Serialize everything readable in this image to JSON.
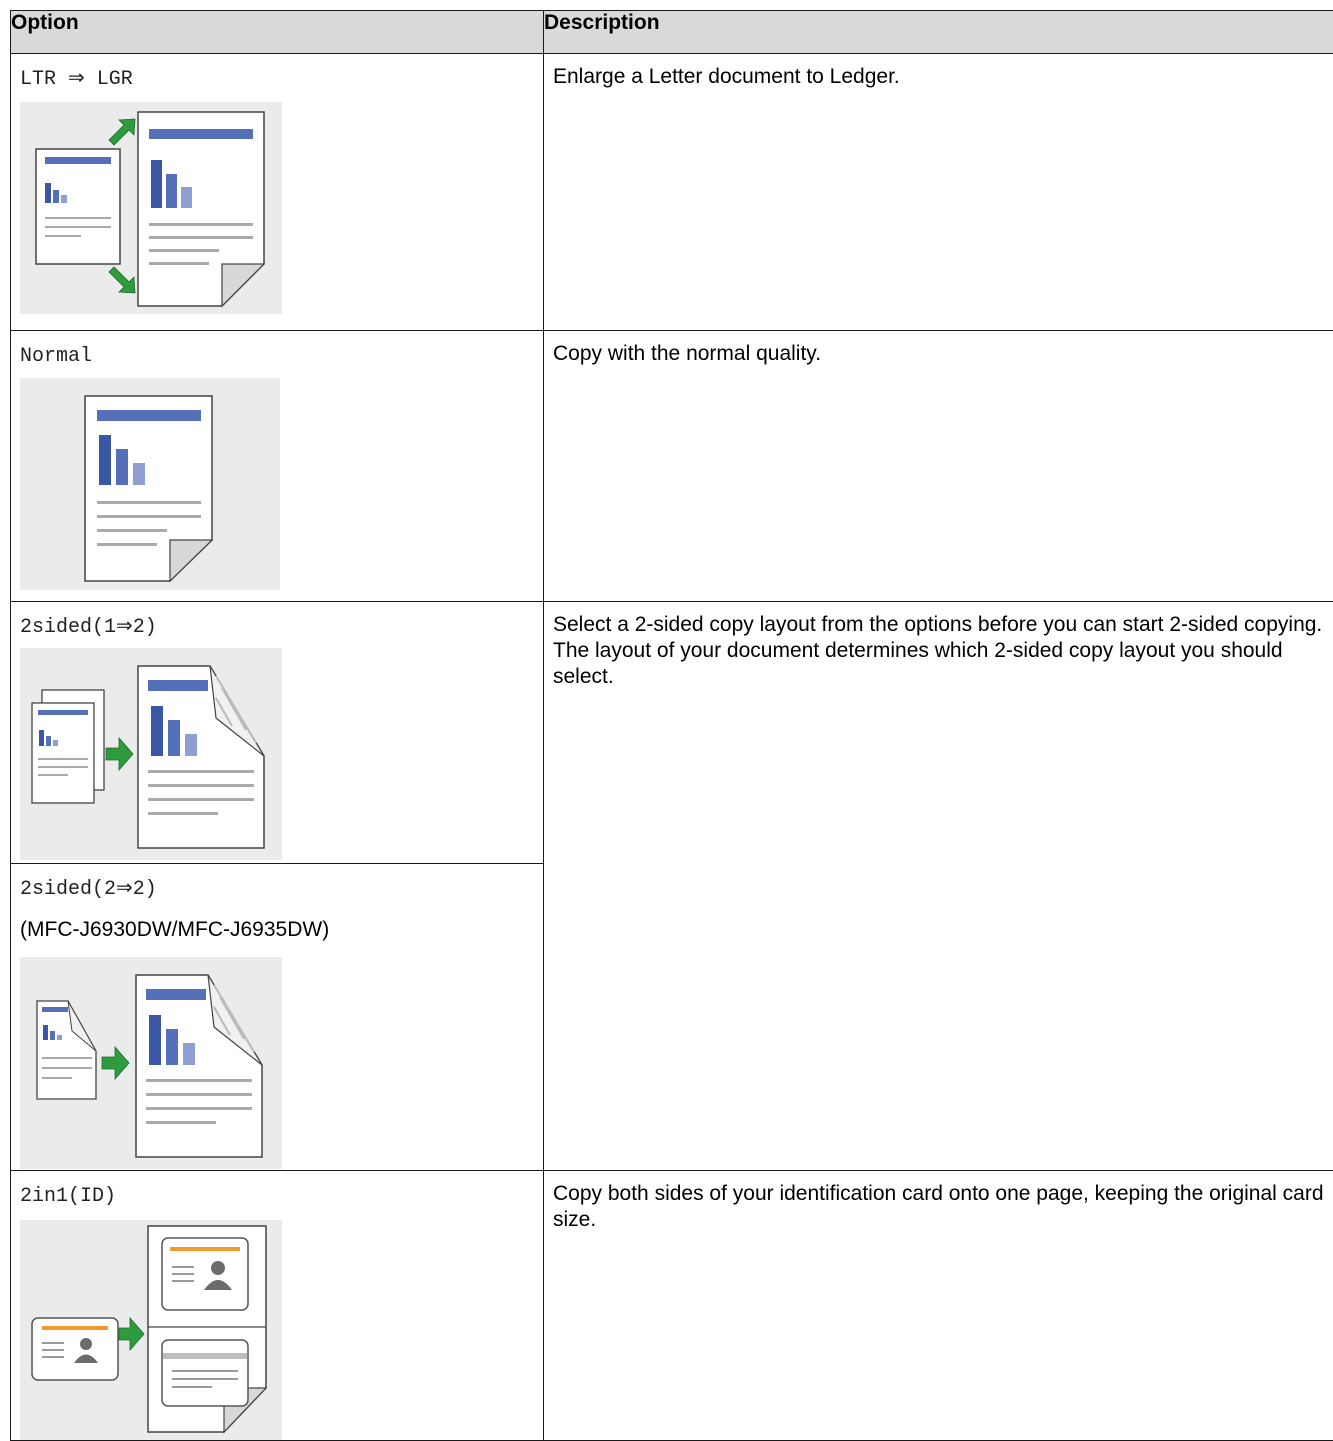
{
  "table": {
    "headers": {
      "option": "Option",
      "description": "Description"
    },
    "rows": [
      {
        "option": "LTR ⇒ LGR",
        "icon": "enlarge-letter-to-ledger-illustration",
        "description": "Enlarge a Letter document to Ledger."
      },
      {
        "option": "Normal",
        "icon": "normal-copy-illustration",
        "description": "Copy with the normal quality."
      },
      {
        "option": "2sided(1⇒2)",
        "icon": "two-sided-1-to-2-illustration",
        "description": "Select a 2-sided copy layout from the options before you can start 2-sided copying. The layout of your document determines which 2-sided copy layout you should select."
      },
      {
        "option": "2sided(2⇒2)",
        "note": "(MFC-J6930DW/MFC-J6935DW)",
        "icon": "two-sided-2-to-2-illustration"
      },
      {
        "option": "2in1(ID)",
        "icon": "two-in-one-id-illustration",
        "description": "Copy both sides of your identification card onto one page, keeping the original card size."
      }
    ]
  },
  "colors": {
    "header_bg": "#d9d9d9",
    "illustration_bg": "#ebebeb",
    "doc_blue": "#5470b8",
    "arrow_green": "#2e9c3e",
    "id_orange": "#f39a2c"
  }
}
